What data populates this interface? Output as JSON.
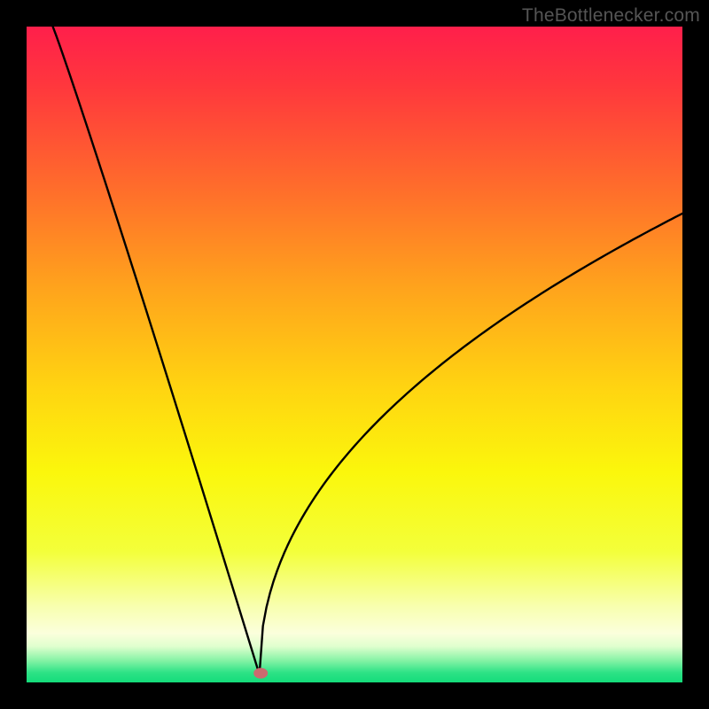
{
  "watermark": "TheBottlenecker.com",
  "chart_data": {
    "type": "line",
    "title": "",
    "xlabel": "",
    "ylabel": "",
    "xlim": [
      0,
      1
    ],
    "ylim": [
      0,
      1
    ],
    "background_gradient": {
      "stops": [
        {
          "offset": 0.0,
          "color": "#ff1f4b"
        },
        {
          "offset": 0.09,
          "color": "#ff373d"
        },
        {
          "offset": 0.25,
          "color": "#ff6e2b"
        },
        {
          "offset": 0.4,
          "color": "#ffa41c"
        },
        {
          "offset": 0.55,
          "color": "#ffd411"
        },
        {
          "offset": 0.68,
          "color": "#fbf70c"
        },
        {
          "offset": 0.8,
          "color": "#f3ff3a"
        },
        {
          "offset": 0.885,
          "color": "#f8ffb0"
        },
        {
          "offset": 0.925,
          "color": "#fbffdc"
        },
        {
          "offset": 0.945,
          "color": "#e0ffce"
        },
        {
          "offset": 0.965,
          "color": "#8cf4a8"
        },
        {
          "offset": 0.985,
          "color": "#2de286"
        },
        {
          "offset": 1.0,
          "color": "#14dc7a"
        }
      ]
    },
    "curve": {
      "description": "V-shaped bottleneck curve; left branch nearly linear, right branch decelerating (square-root-like).",
      "x0": 0.355,
      "left_branch": {
        "x_start": 0.04,
        "y_start": 1.0,
        "x_end": 0.355,
        "y_end": 0.012
      },
      "right_branch": {
        "x_start": 0.355,
        "y_start": 0.012,
        "x_end": 1.0,
        "y_end": 0.715,
        "shape": "sqrt"
      }
    },
    "marker": {
      "x": 0.357,
      "y": 0.014,
      "color": "#cc6a6f",
      "rx": 8,
      "ry": 6
    }
  }
}
